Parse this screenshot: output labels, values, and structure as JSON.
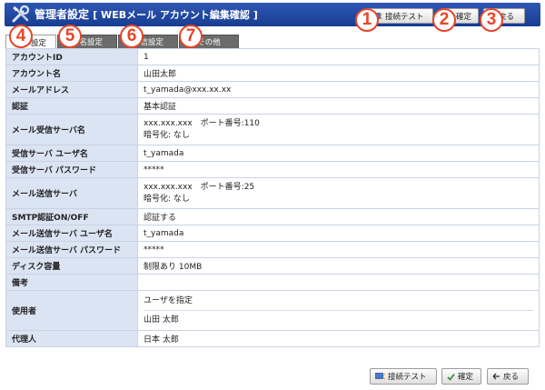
{
  "header": {
    "title": "管理者設定",
    "subtitle": "[ WEBメール アカウント編集確認 ]",
    "buttons": {
      "test": "接続テスト",
      "confirm": "確定",
      "back": "戻る"
    }
  },
  "badges": [
    "1",
    "2",
    "3",
    "4",
    "5",
    "6",
    "7"
  ],
  "tabs": [
    {
      "label": "基本設定",
      "active": true
    },
    {
      "label": "署名設定",
      "active": false
    },
    {
      "label": "受信設定",
      "active": false
    },
    {
      "label": "その他",
      "active": false
    }
  ],
  "rows": [
    {
      "key": "アカウントID",
      "value": "1"
    },
    {
      "key": "アカウント名",
      "value": "山田太郎"
    },
    {
      "key": "メールアドレス",
      "value": "t_yamada@xxx.xx.xx"
    },
    {
      "key": "認証",
      "value": "基本認証"
    },
    {
      "key": "メール受信サーバ名",
      "line1": "xxx.xxx.xxx　ポート番号:110",
      "line2": "暗号化: なし"
    },
    {
      "key": "受信サーバ ユーザ名",
      "value": "t_yamada"
    },
    {
      "key": "受信サーバ パスワード",
      "value": "*****"
    },
    {
      "key": "メール送信サーバ",
      "line1": "xxx.xxx.xxx　ポート番号:25",
      "line2": "暗号化: なし"
    },
    {
      "key": "SMTP認証ON/OFF",
      "value": "認証する"
    },
    {
      "key": "メール送信サーバ ユーザ名",
      "value": "t_yamada"
    },
    {
      "key": "メール送信サーバ パスワード",
      "value": "*****"
    },
    {
      "key": "ディスク容量",
      "value": "制限あり 10MB"
    },
    {
      "key": "備考",
      "value": ""
    },
    {
      "key": "使用者",
      "line1": "ユーザを指定",
      "line2": "山田 太郎"
    },
    {
      "key": "代理人",
      "value": "日本 太郎"
    }
  ],
  "footer": {
    "test": "接続テスト",
    "confirm": "確定",
    "back": "戻る"
  },
  "colors": {
    "header": "#1f47a0",
    "badge": "#e6452a",
    "label_bg": "#dbe4f2",
    "border": "#c9d3e3"
  }
}
